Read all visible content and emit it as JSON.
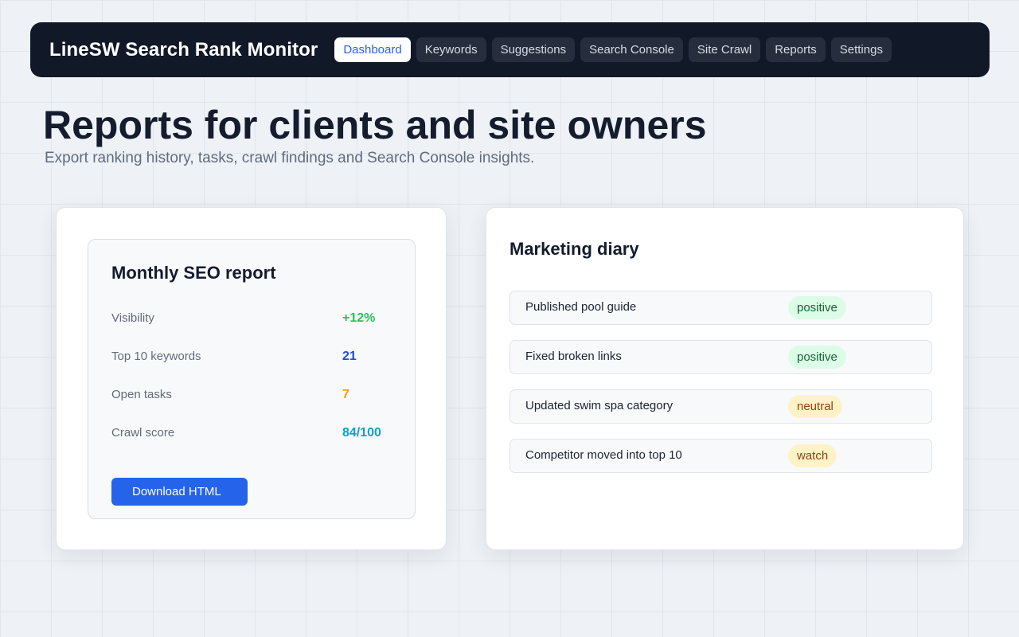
{
  "app": {
    "title": "LineSW Search Rank Monitor"
  },
  "nav": {
    "items": [
      {
        "label": "Dashboard",
        "active": true
      },
      {
        "label": "Keywords",
        "active": false
      },
      {
        "label": "Suggestions",
        "active": false
      },
      {
        "label": "Search Console",
        "active": false
      },
      {
        "label": "Site Crawl",
        "active": false
      },
      {
        "label": "Reports",
        "active": false
      },
      {
        "label": "Settings",
        "active": false
      }
    ]
  },
  "page": {
    "title": "Reports for clients and site owners",
    "subtitle": "Export ranking history, tasks, crawl findings and Search Console insights."
  },
  "report": {
    "title": "Monthly SEO report",
    "metrics": [
      {
        "label": "Visibility",
        "value": "+12%",
        "color": "#22c55e"
      },
      {
        "label": "Top 10 keywords",
        "value": "21",
        "color": "#1d4ed8"
      },
      {
        "label": "Open tasks",
        "value": "7",
        "color": "#f59e0b"
      },
      {
        "label": "Crawl score",
        "value": "84/100",
        "color": "#06a3c9"
      }
    ],
    "download_label": "Download HTML"
  },
  "diary": {
    "title": "Marketing diary",
    "entries": [
      {
        "text": "Published pool guide",
        "status": "positive"
      },
      {
        "text": "Fixed broken links",
        "status": "positive"
      },
      {
        "text": "Updated swim spa category",
        "status": "neutral"
      },
      {
        "text": "Competitor moved into top 10",
        "status": "watch"
      }
    ]
  },
  "colors": {
    "accent": "#2563eb",
    "nav_bg": "#111827",
    "badge_positive_bg": "#dcfce7",
    "badge_positive_fg": "#166534",
    "badge_warn_bg": "#fef3c7",
    "badge_warn_fg": "#92400e"
  }
}
